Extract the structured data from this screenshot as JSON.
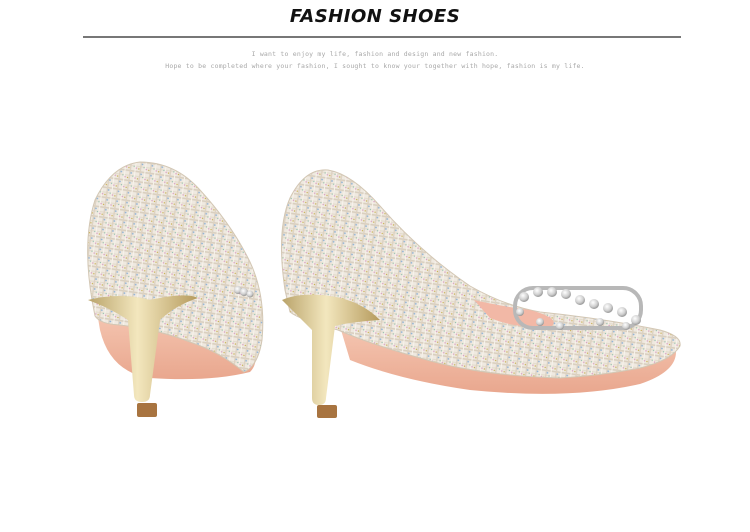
{
  "header": {
    "title": "FASHION SHOES",
    "tagline_1": "I want to enjoy my life, fashion and design and new fashion.",
    "tagline_2": "Hope to be completed where your fashion, I sought to know your together with hope, fashion is my life."
  },
  "colors": {
    "tweed_base": "#efe9e0",
    "sole_pink": "#f1b8a2",
    "heel_gold": "#d8c48a",
    "heel_tip": "#9a6a3a",
    "rule": "#777777"
  },
  "photo": {
    "subject": "pair-of-tweed-pointed-pumps"
  }
}
